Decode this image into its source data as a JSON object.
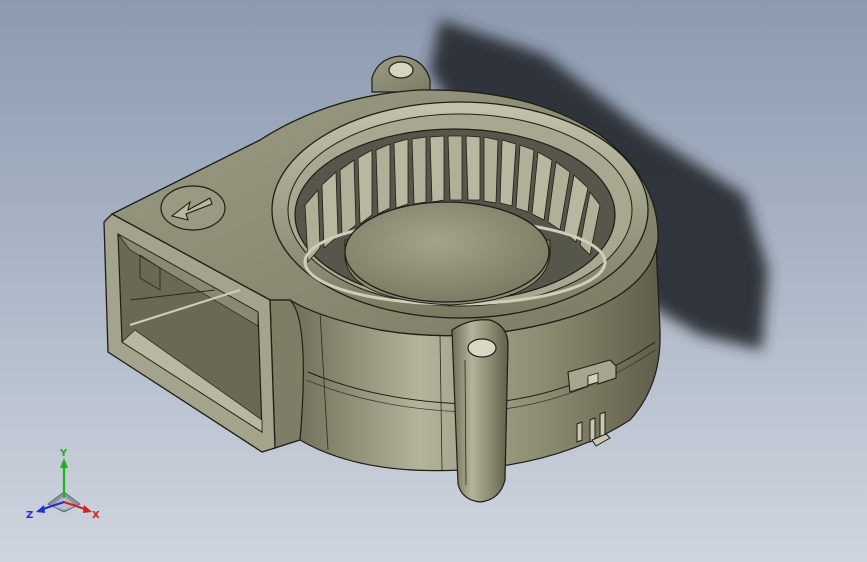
{
  "viewport": {
    "background_top": "#8c9ab0",
    "background_bottom": "#cfd5de"
  },
  "model": {
    "name": "centrifugal-blower-fan",
    "body_color": "#8e8e74",
    "edge_color": "#1e1e16",
    "shadow_color": "#2b2f35",
    "arrow_icon": "direction-arrow-icon"
  },
  "triad": {
    "x_label": "X",
    "y_label": "Y",
    "z_label": "Z",
    "x_color": "#d42020",
    "y_color": "#20b020",
    "z_color": "#2030d0"
  }
}
